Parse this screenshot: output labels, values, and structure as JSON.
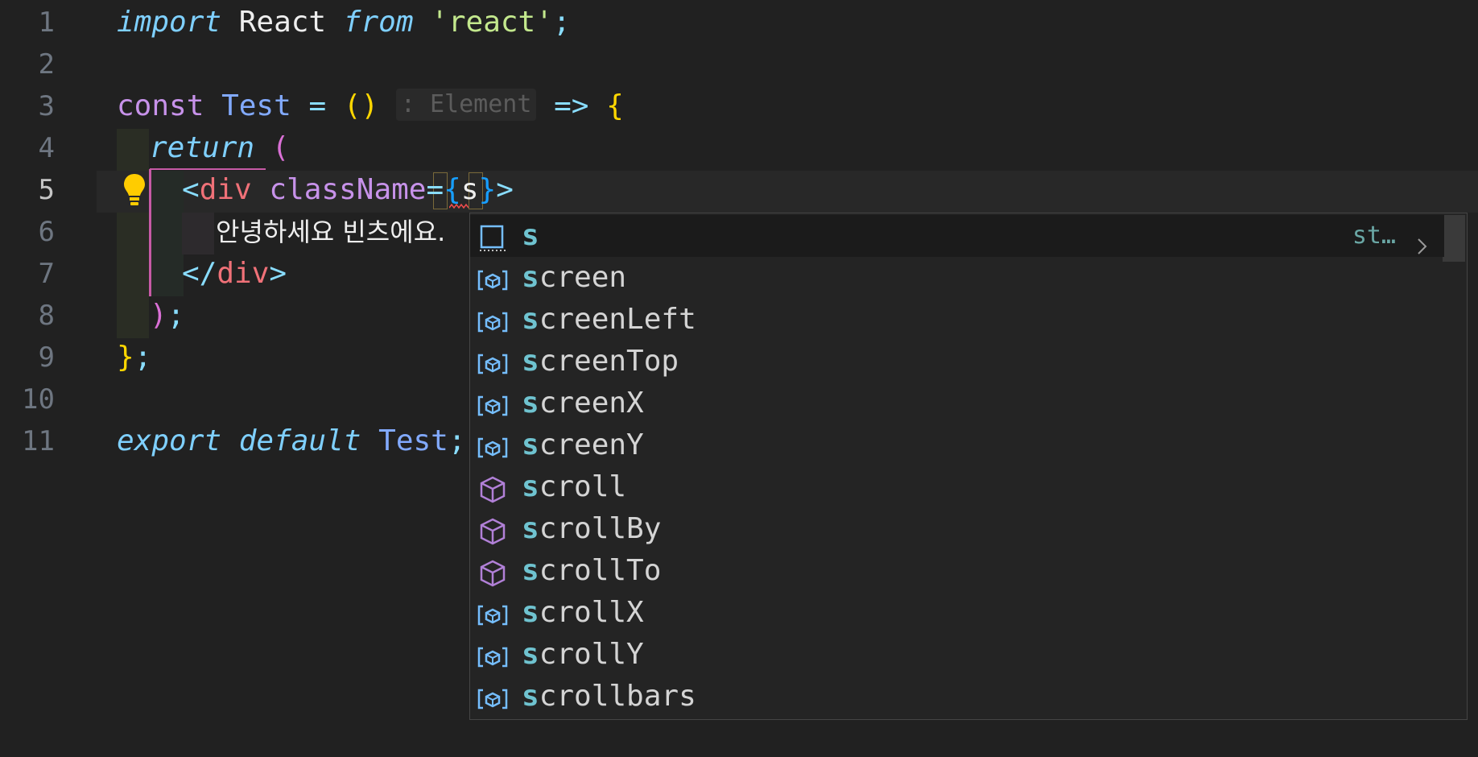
{
  "editor": {
    "line_numbers": [
      "1",
      "2",
      "3",
      "4",
      "5",
      "6",
      "7",
      "8",
      "9",
      "10",
      "11"
    ],
    "active_line": "5",
    "code": {
      "l1": {
        "import": "import",
        "react": "React",
        "from": "from",
        "module": "'react'",
        "semi": ";"
      },
      "l3": {
        "const": "const",
        "name": "Test",
        "eq": "=",
        "parens": "()",
        "hint": ": Element",
        "arrow": "=>",
        "brace": "{"
      },
      "l4": {
        "return": "return",
        "paren": "("
      },
      "l5": {
        "open": "<",
        "tag": "div",
        "attr": "className",
        "eq": "=",
        "lb": "{",
        "typed": "s",
        "rb": "}",
        "close": ">"
      },
      "l6": {
        "text": "안녕하세요 빈츠에요."
      },
      "l7": {
        "open": "</",
        "tag": "div",
        "close": ">"
      },
      "l8": {
        "paren": ")",
        "semi": ";"
      },
      "l9": {
        "brace": "}",
        "semi": ";"
      },
      "l11": {
        "export": "export",
        "default": "default",
        "name": "Test",
        "semi": ";"
      }
    }
  },
  "suggest": {
    "selected_detail": "st…",
    "items": [
      {
        "match": "s",
        "rest": "",
        "kind": "text-icon"
      },
      {
        "match": "s",
        "rest": "creen",
        "kind": "variable-icon"
      },
      {
        "match": "s",
        "rest": "creenLeft",
        "kind": "variable-icon"
      },
      {
        "match": "s",
        "rest": "creenTop",
        "kind": "variable-icon"
      },
      {
        "match": "s",
        "rest": "creenX",
        "kind": "variable-icon"
      },
      {
        "match": "s",
        "rest": "creenY",
        "kind": "variable-icon"
      },
      {
        "match": "s",
        "rest": "croll",
        "kind": "method-icon"
      },
      {
        "match": "s",
        "rest": "crollBy",
        "kind": "method-icon"
      },
      {
        "match": "s",
        "rest": "crollTo",
        "kind": "method-icon"
      },
      {
        "match": "s",
        "rest": "crollX",
        "kind": "variable-icon"
      },
      {
        "match": "s",
        "rest": "crollY",
        "kind": "variable-icon"
      },
      {
        "match": "s",
        "rest": "crollbars",
        "kind": "variable-icon"
      }
    ]
  },
  "colors": {
    "background": "#212121",
    "keyword_italic": "#7fd0ff",
    "keyword": "#c792ea",
    "string": "#c3e88d",
    "tag": "#f07178",
    "match_highlight": "#6fc3d0"
  }
}
